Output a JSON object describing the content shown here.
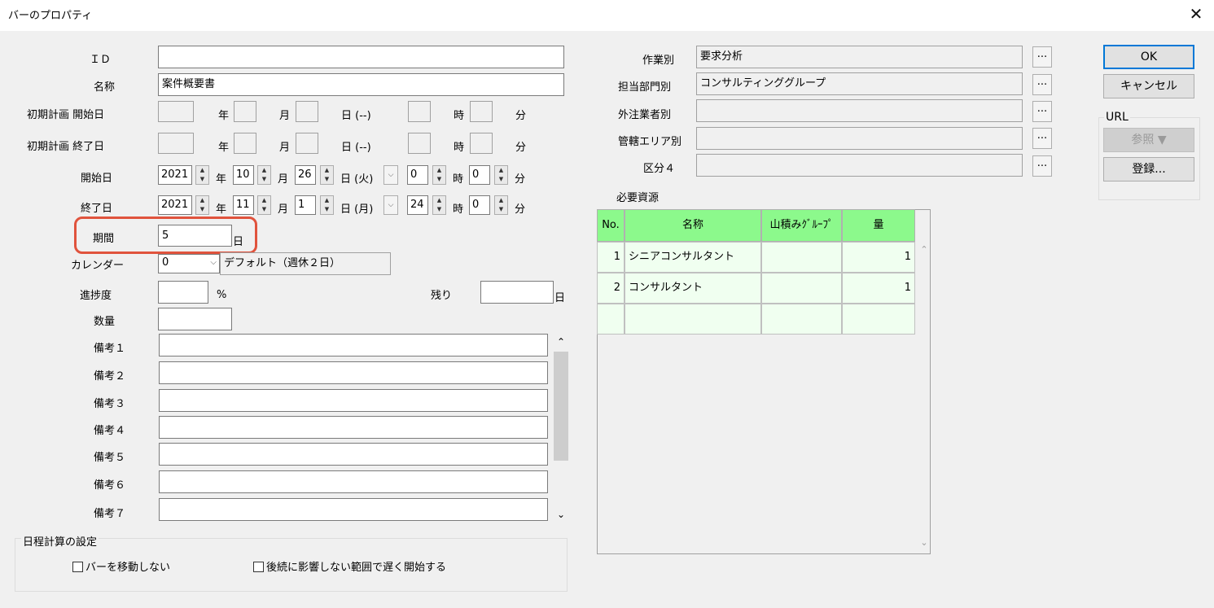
{
  "window": {
    "title": "バーのプロパティ",
    "close": "✕"
  },
  "labels": {
    "id": "ＩＤ",
    "name": "名称",
    "init_start": "初期計画 開始日",
    "init_end": "初期計画 終了日",
    "start": "開始日",
    "end": "終了日",
    "period": "期間",
    "calendar": "カレンダー",
    "progress": "進捗度",
    "remaining": "残り",
    "quantity": "数量",
    "notes": [
      "備考１",
      "備考２",
      "備考３",
      "備考４",
      "備考５",
      "備考６",
      "備考７"
    ],
    "year": "年",
    "month": "月",
    "day_blank": "日 (--)",
    "hour": "時",
    "minute": "分",
    "day": "日",
    "percent": "%"
  },
  "fields": {
    "id": "",
    "name": "案件概要書",
    "start": {
      "year": "2021",
      "month": "10",
      "day": "26",
      "weekday": "日 (火)",
      "hour": "0",
      "minute": "0"
    },
    "end": {
      "year": "2021",
      "month": "11",
      "day": "1",
      "weekday": "日 (月)",
      "hour": "24",
      "minute": "0"
    },
    "period": "5",
    "calendar_no": "0",
    "calendar_name": "デフォルト（週休２日）"
  },
  "right": {
    "work_type_label": "作業別",
    "work_type": "要求分析",
    "dept_label": "担当部門別",
    "dept": "コンサルティンググループ",
    "vendor_label": "外注業者別",
    "vendor": "",
    "area_label": "管轄エリア別",
    "area": "",
    "class4_label": "区分４",
    "class4": "",
    "ellipsis": "...",
    "resources_label": "必要資源"
  },
  "grid": {
    "headers": [
      "No.",
      "名称",
      "山積みｸﾞﾙｰﾌﾟ",
      "量"
    ],
    "rows": [
      {
        "no": "1",
        "name": "シニアコンサルタント",
        "group": "",
        "qty": "1"
      },
      {
        "no": "2",
        "name": "コンサルタント",
        "group": "",
        "qty": "1"
      }
    ]
  },
  "buttons": {
    "ok": "OK",
    "cancel": "キャンセル",
    "url_group": "URL",
    "browse": "参照 ▼",
    "register": "登録..."
  },
  "schedule": {
    "group_label": "日程計算の設定",
    "no_move": "バーを移動しない",
    "late_start": "後続に影響しない範囲で遅く開始する"
  },
  "colors": {
    "grid_header": "#8cf98c",
    "grid_cell": "#f0fff0",
    "highlight": "#e0533d",
    "ok_border": "#0078d7"
  }
}
